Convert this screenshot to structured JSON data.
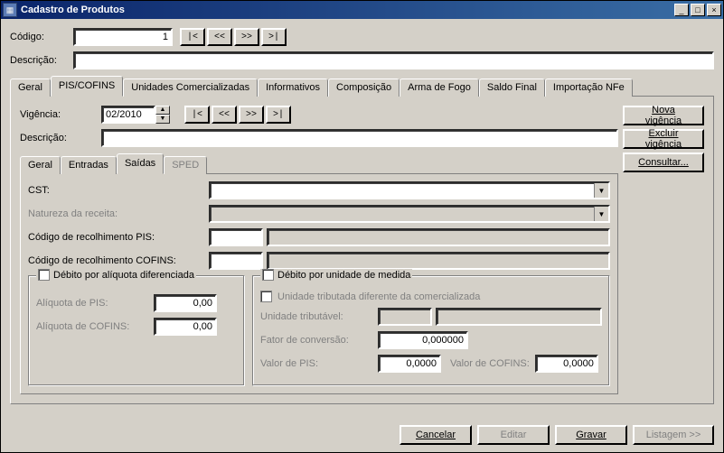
{
  "window": {
    "title": "Cadastro de Produtos",
    "controls": {
      "min": "_",
      "max": "□",
      "close": "×"
    }
  },
  "header": {
    "codigo_label": "Código:",
    "codigo_value": "1",
    "descricao_label": "Descrição:",
    "descricao_value": "",
    "nav": {
      "first": "|<",
      "prev": "<<",
      "next": ">>",
      "last": ">|"
    }
  },
  "tabs_main": {
    "items": [
      "Geral",
      "PIS/COFINS",
      "Unidades Comercializadas",
      "Informativos",
      "Composição",
      "Arma de Fogo",
      "Saldo Final",
      "Importação NFe"
    ],
    "active": 1
  },
  "piscofins": {
    "vigencia_label": "Vigência:",
    "vigencia_value": "02/2010",
    "nav": {
      "first": "|<",
      "prev": "<<",
      "next": ">>",
      "last": ">|"
    },
    "descricao_label": "Descrição:",
    "descricao_value": "",
    "side_buttons": {
      "nova": "Nova vigência",
      "excluir": "Excluir vigência",
      "consultar": "Consultar..."
    }
  },
  "tabs_sub": {
    "items": [
      "Geral",
      "Entradas",
      "Saídas",
      "SPED"
    ],
    "active": 2,
    "disabled": [
      3
    ]
  },
  "saidas": {
    "cst_label": "CST:",
    "natureza_label": "Natureza da receita:",
    "cod_pis_label": "Código de recolhimento PIS:",
    "cod_pis_value": "",
    "cod_cofins_label": "Código de recolhimento COFINS:",
    "cod_cofins_value": "",
    "grp_aliquota": {
      "legend": "Débito por alíquota diferenciada",
      "pis_label": "Alíquota de PIS:",
      "pis_value": "0,00",
      "cofins_label": "Alíquota de COFINS:",
      "cofins_value": "0,00"
    },
    "grp_unidade": {
      "legend": "Débito por unidade de medida",
      "chk_label": "Unidade tributada diferente da comercializada",
      "unidade_label": "Unidade tributável:",
      "fator_label": "Fator de conversão:",
      "fator_value": "0,000000",
      "valpis_label": "Valor de PIS:",
      "valpis_value": "0,0000",
      "valcofins_label": "Valor de COFINS:",
      "valcofins_value": "0,0000"
    }
  },
  "footer": {
    "cancelar": "Cancelar",
    "editar": "Editar",
    "gravar": "Gravar",
    "listagem": "Listagem >>"
  }
}
